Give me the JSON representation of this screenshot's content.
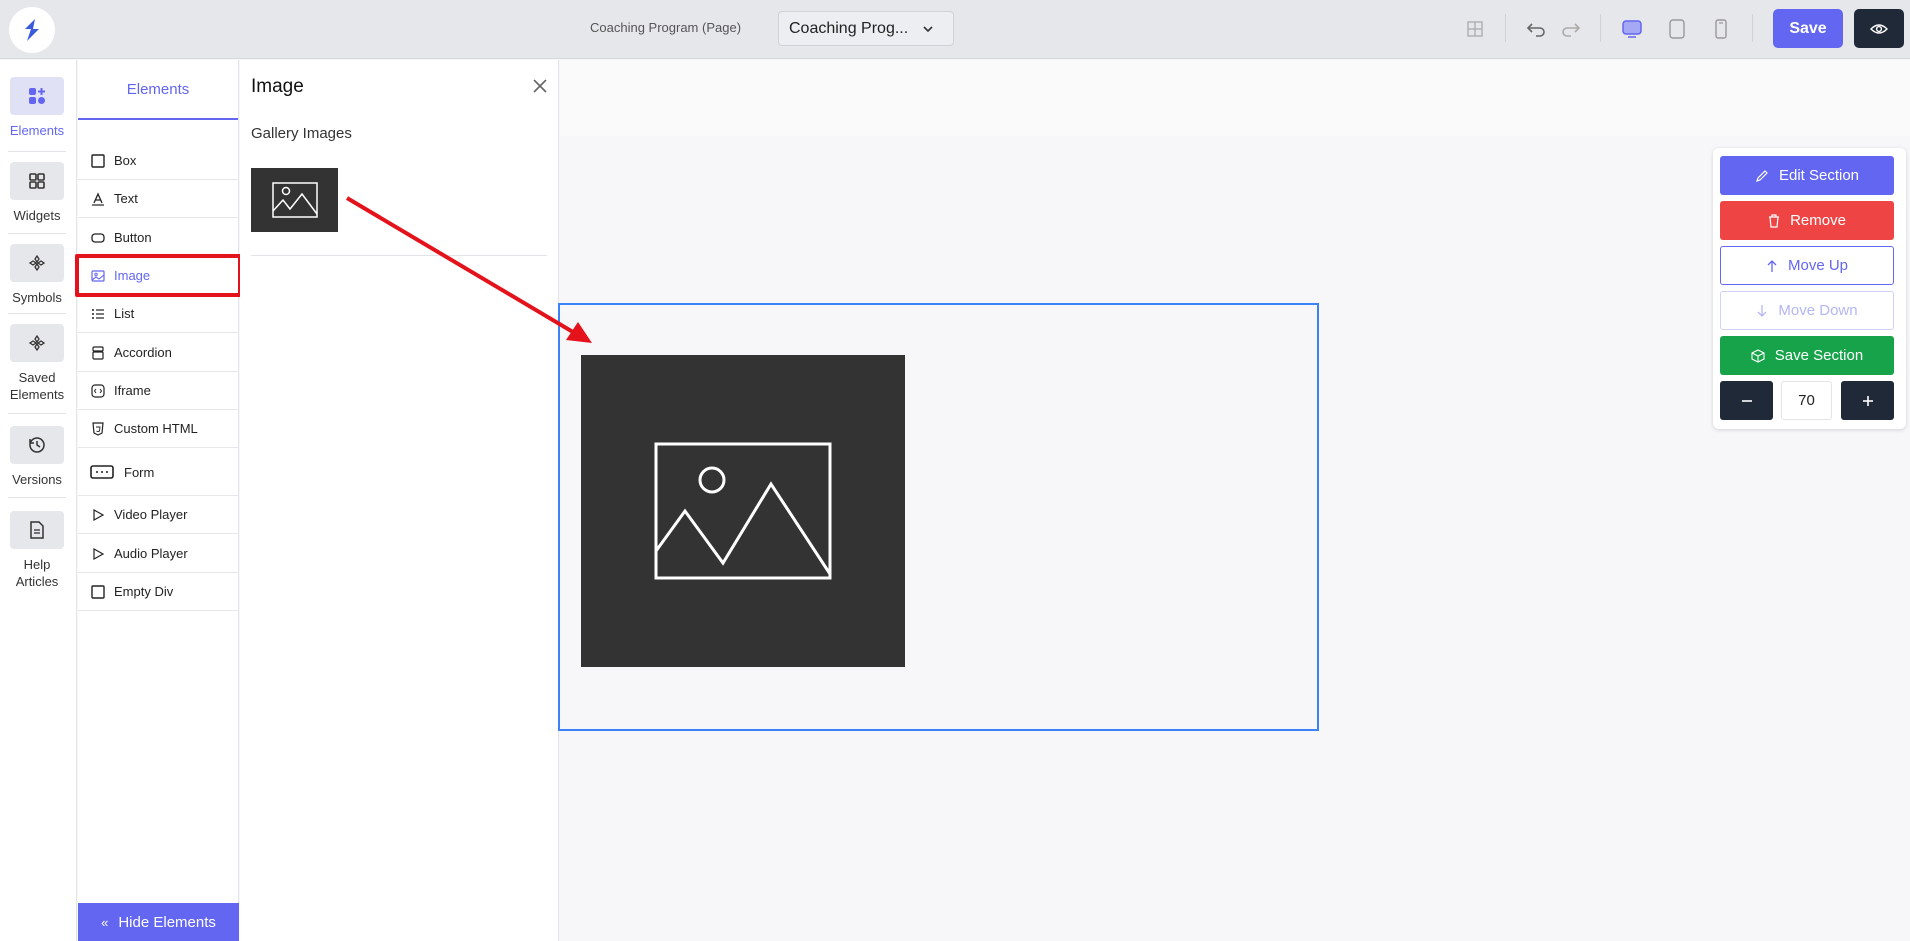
{
  "topbar": {
    "page_label": "Coaching Program (Page)",
    "page_select_value": "Coaching Prog...",
    "save_label": "Save"
  },
  "rail": {
    "items": [
      {
        "label": "Elements",
        "icon": "elements-icon"
      },
      {
        "label": "Widgets",
        "icon": "widgets-icon"
      },
      {
        "label": "Symbols",
        "icon": "symbols-icon"
      },
      {
        "label": "Saved Elements",
        "icon": "saved-elements-icon"
      },
      {
        "label": "Versions",
        "icon": "history-icon"
      },
      {
        "label": "Help Articles",
        "icon": "document-icon"
      }
    ]
  },
  "elements_panel": {
    "tab": "Elements",
    "items": [
      {
        "label": "Box",
        "icon": "square-icon"
      },
      {
        "label": "Text",
        "icon": "text-icon"
      },
      {
        "label": "Button",
        "icon": "button-icon"
      },
      {
        "label": "Image",
        "icon": "image-icon"
      },
      {
        "label": "List",
        "icon": "list-icon"
      },
      {
        "label": "Accordion",
        "icon": "accordion-icon"
      },
      {
        "label": "Iframe",
        "icon": "iframe-icon"
      },
      {
        "label": "Custom HTML",
        "icon": "html-icon"
      },
      {
        "label": "Form",
        "icon": "form-icon"
      },
      {
        "label": "Video Player",
        "icon": "play-icon"
      },
      {
        "label": "Audio Player",
        "icon": "play-icon"
      },
      {
        "label": "Empty Div",
        "icon": "square-icon"
      }
    ],
    "hide_label": "Hide Elements"
  },
  "image_panel": {
    "title": "Image",
    "gallery_label": "Gallery Images"
  },
  "section_tools": {
    "edit": "Edit Section",
    "remove": "Remove",
    "move_up": "Move Up",
    "move_down": "Move Down",
    "save_section": "Save Section",
    "zoom_value": "70"
  },
  "colors": {
    "accent": "#6366f1",
    "danger": "#ef4444",
    "success": "#16a34a",
    "dark": "#1f2937",
    "highlight": "#e3121b"
  }
}
